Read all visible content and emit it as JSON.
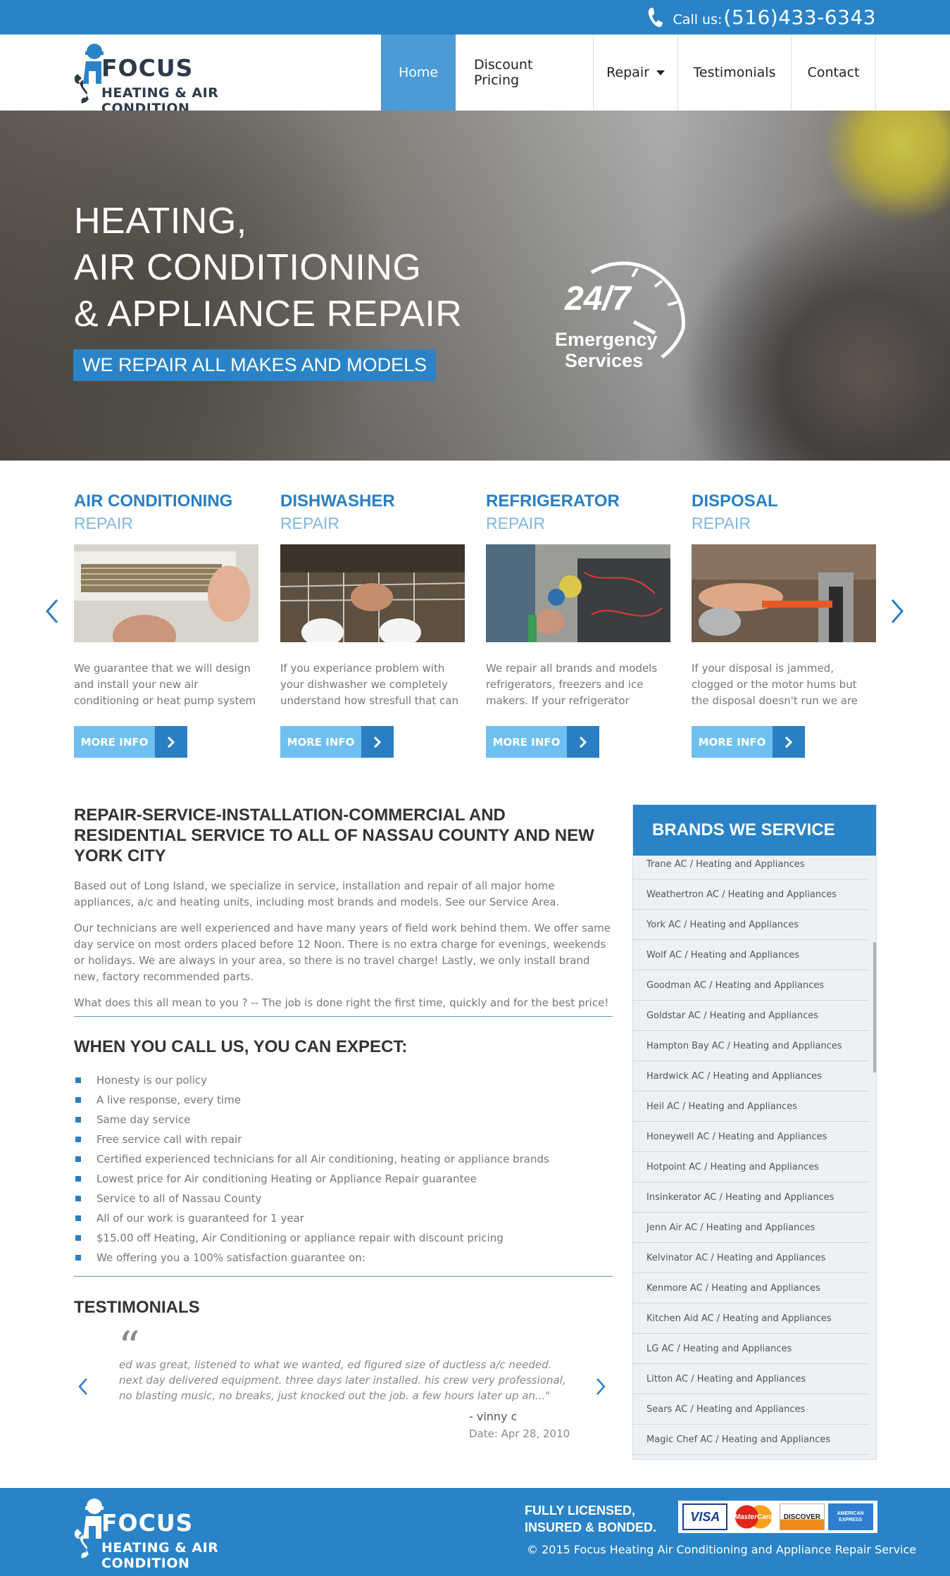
{
  "topbar": {
    "call_label": "Call us:",
    "phone": "(516)433-6343"
  },
  "brand": {
    "name_line1": "FOCUS",
    "name_line2": "HEATING & AIR CONDITION"
  },
  "nav": [
    {
      "label": "Home",
      "active": true
    },
    {
      "label": "Discount Pricing"
    },
    {
      "label": "Repair",
      "has_dropdown": true
    },
    {
      "label": "Testimonials"
    },
    {
      "label": "Contact"
    }
  ],
  "hero": {
    "line1": "HEATING,",
    "line2": "AIR CONDITIONING",
    "line3": "& APPLIANCE REPAIR",
    "tagline": "WE REPAIR ALL MAKES AND MODELS",
    "badge_top": "24/7",
    "badge_line1": "Emergency",
    "badge_line2": "Services"
  },
  "services": [
    {
      "title": "AIR CONDITIONING",
      "subtitle": "REPAIR",
      "desc": "We guarantee that we will design and install your new air conditioning or heat pump system in accordance",
      "button": "MORE INFO"
    },
    {
      "title": "DISHWASHER",
      "subtitle": "REPAIR",
      "desc": "If you experiance problem with your dishwasher we completely understand how stresfull that can be.",
      "button": "MORE INFO"
    },
    {
      "title": "REFRIGERATOR",
      "subtitle": "REPAIR",
      "desc": "We repair all brands and models refrigerators, freezers and ice makers. If your refrigerator doesn't",
      "button": "MORE INFO"
    },
    {
      "title": "DISPOSAL",
      "subtitle": "REPAIR",
      "desc": "If your disposal is jammed, clogged or the motor hums but the disposal doesn't run we are ready to help.",
      "button": "MORE INFO"
    }
  ],
  "about": {
    "heading": "REPAIR-SERVICE-INSTALLATION-COMMERCIAL AND RESIDENTIAL SERVICE TO ALL OF NASSAU COUNTY AND NEW YORK CITY",
    "p1": "Based out of Long Island, we specialize in service, installation and repair of all major home appliances, a/c and heating units, including most brands and models. See our Service Area.",
    "p2": "Our technicians are well experienced and have many years of field work behind them. We offer same day service on most orders placed before 12 Noon. There is no extra charge for evenings, weekends or holidays. We are always in your area, so there is no travel charge! Lastly, we only install brand new, factory recommended parts.",
    "p3": "What does this all mean to you ? -- The job is done right the first time, quickly and for the best price!"
  },
  "expect": {
    "heading": "WHEN YOU CALL US, YOU CAN EXPECT:",
    "items": [
      "Honesty is our policy",
      "A live response, every time",
      "Same day service",
      "Free service call with repair",
      "Certified experienced technicians for all Air conditioning, heating or appliance brands",
      "Lowest price for Air conditioning Heating or Appliance Repair guarantee",
      "Service to all of Nassau County",
      "All of our work is guaranteed for 1 year",
      "$15.00 off Heating, Air Conditioning or appliance repair with discount pricing",
      "We offering you a 100% satisfaction guarantee on:"
    ]
  },
  "testimonials": {
    "heading": "TESTIMONIALS",
    "quote": "ed was great, listened to what we wanted, ed figured size of ductless a/c needed. next day delivered equipment. three days later installed. his crew very professional, no blasting music, no breaks, just knocked out the job. a few hours later up an...\"",
    "author": "- vinny c",
    "date": "Date: Apr 28, 2010"
  },
  "brands": {
    "heading": "BRANDS WE SERVICE",
    "items": [
      "Trane AC / Heating and Appliances",
      "Weathertron AC / Heating and Appliances",
      "York AC / Heating and Appliances",
      "Wolf AC / Heating and Appliances",
      "Goodman AC / Heating and Appliances",
      "Goldstar AC / Heating and Appliances",
      "Hampton Bay AC / Heating and Appliances",
      "Hardwick AC / Heating and Appliances",
      "Heil AC / Heating and Appliances",
      "Honeywell AC / Heating and Appliances",
      "Hotpoint AC / Heating and Appliances",
      "Insinkerator AC / Heating and Appliances",
      "Jenn Air AC / Heating and Appliances",
      "Kelvinator AC / Heating and Appliances",
      "Kenmore AC / Heating and Appliances",
      "Kitchen Aid AC / Heating and Appliances",
      "LG AC / Heating and Appliances",
      "Litton AC / Heating and Appliances",
      "Sears AC / Heating and Appliances",
      "Magic Chef AC / Heating and Appliances"
    ]
  },
  "footer": {
    "licensed_line1": "FULLY LICENSED,",
    "licensed_line2": "INSURED & BONDED.",
    "cards": [
      "VISA",
      "MasterCard",
      "DISCOVER",
      "AMERICAN EXPRESS"
    ],
    "copyright": "© 2015 Focus Heating Air Conditioning and Appliance Repair Service"
  },
  "colors": {
    "primary": "#2a83c7",
    "light_blue": "#6fc0f0",
    "dark_text": "#333333"
  }
}
